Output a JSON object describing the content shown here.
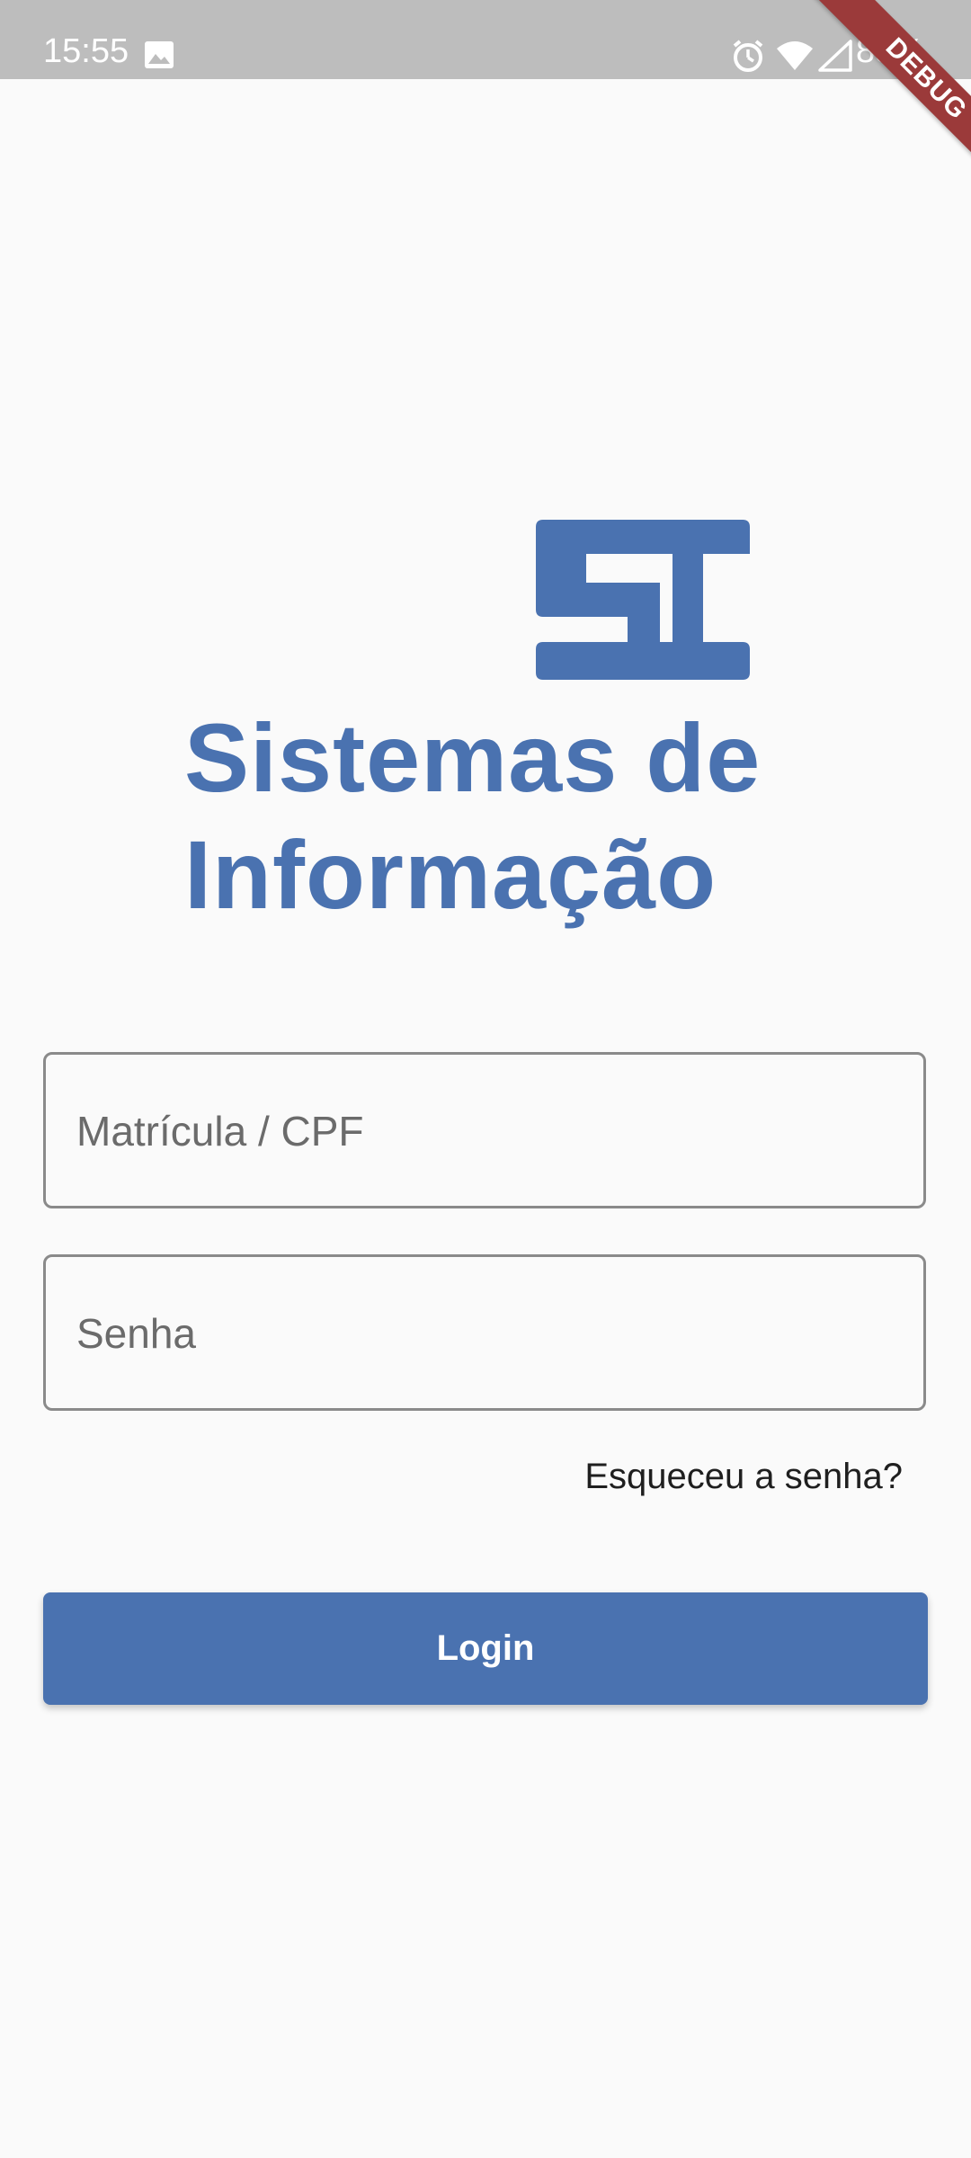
{
  "status_bar": {
    "time": "15:55",
    "battery": "88%",
    "icons": [
      "image-icon",
      "alarm-icon",
      "wifi-icon",
      "signal-icon"
    ]
  },
  "debug_banner": {
    "label": "DEBUG"
  },
  "logo": {
    "line1": "Sistemas de",
    "line2": "Informação",
    "color": "#4a72b0"
  },
  "form": {
    "registration_placeholder": "Matrícula / CPF",
    "password_placeholder": "Senha",
    "forgot_password": "Esqueceu a senha?",
    "login_button": "Login"
  },
  "colors": {
    "accent": "#4a72b0",
    "background": "#fafafa",
    "status_bar": "#bdbdbd",
    "debug_banner": "#9b3a3a"
  }
}
